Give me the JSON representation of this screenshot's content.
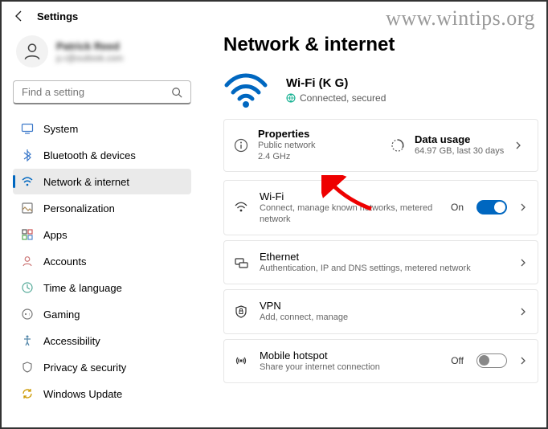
{
  "watermark": "www.wintips.org",
  "header": {
    "title": "Settings"
  },
  "user": {
    "name": "Patrick Reed",
    "email": "p.r@outlook.com"
  },
  "search": {
    "placeholder": "Find a setting"
  },
  "nav": {
    "system": "System",
    "bluetooth": "Bluetooth & devices",
    "network": "Network & internet",
    "personalization": "Personalization",
    "apps": "Apps",
    "accounts": "Accounts",
    "time": "Time & language",
    "gaming": "Gaming",
    "accessibility": "Accessibility",
    "privacy": "Privacy & security",
    "update": "Windows Update"
  },
  "page": {
    "title": "Network & internet",
    "wifi_name": "Wi-Fi (K G)",
    "wifi_status": "Connected, secured",
    "properties": {
      "title": "Properties",
      "line1": "Public network",
      "line2": "2.4 GHz"
    },
    "datausage": {
      "title": "Data usage",
      "line1": "64.97 GB, last 30 days"
    },
    "cards": {
      "wifi": {
        "title": "Wi-Fi",
        "sub": "Connect, manage known networks, metered network",
        "state": "On"
      },
      "ethernet": {
        "title": "Ethernet",
        "sub": "Authentication, IP and DNS settings, metered network"
      },
      "vpn": {
        "title": "VPN",
        "sub": "Add, connect, manage"
      },
      "hotspot": {
        "title": "Mobile hotspot",
        "sub": "Share your internet connection",
        "state": "Off"
      }
    }
  }
}
